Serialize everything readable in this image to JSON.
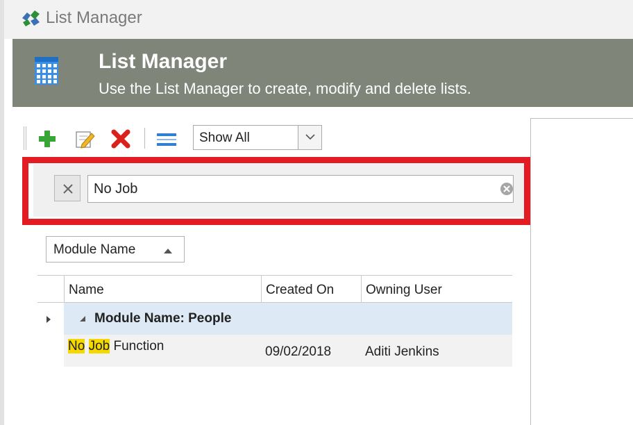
{
  "window": {
    "title": "List Manager"
  },
  "banner": {
    "heading": "List Manager",
    "subtitle": "Use the List Manager to create, modify and delete lists."
  },
  "toolbar": {
    "add_icon": "plus-icon",
    "edit_icon": "edit-icon",
    "delete_icon": "delete-icon",
    "view_icon": "list-view-icon",
    "filter_select": {
      "selected": "Show All"
    }
  },
  "search": {
    "value": "No Job"
  },
  "group_by": {
    "label": "Module Name",
    "sort": "ascending"
  },
  "grid": {
    "columns": [
      "Name",
      "Created On",
      "Owning User"
    ],
    "group": {
      "label": "Module Name: People"
    },
    "rows": [
      {
        "name_parts": [
          {
            "text": "No",
            "highlight": true
          },
          {
            "text": " ",
            "highlight": false
          },
          {
            "text": "Job",
            "highlight": true
          },
          {
            "text": " Function",
            "highlight": false
          }
        ],
        "created_on": "09/02/2018",
        "owning_user": "Aditi Jenkins"
      }
    ]
  },
  "colors": {
    "banner": "#7f8579",
    "highlight_box": "#e31b23",
    "group_row": "#dde9f5",
    "match_highlight": "#f5d800"
  }
}
